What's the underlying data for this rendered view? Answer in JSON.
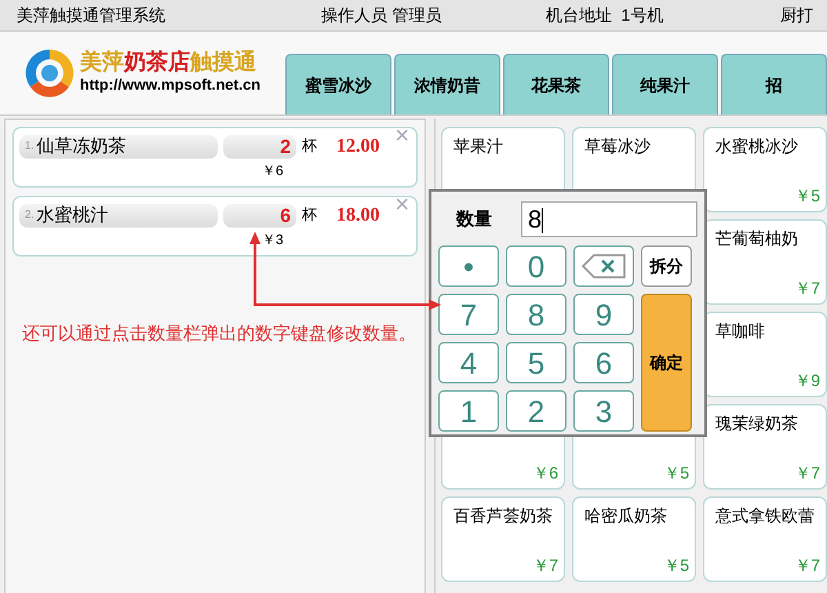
{
  "top_bar": {
    "app_name": "美萍触摸通管理系统",
    "operator": "操作人员 管理员",
    "terminal": "机台地址  1号机",
    "cut_text": "厨打"
  },
  "logo": {
    "parts": [
      {
        "text": "美萍",
        "color": "#d9a520"
      },
      {
        "text": "奶茶店",
        "color": "#d42020"
      },
      {
        "text": "触摸通",
        "color": "#d9a520"
      }
    ],
    "url": "http://www.mpsoft.net.cn"
  },
  "tabs": [
    {
      "label": "蜜雪冰沙"
    },
    {
      "label": "浓情奶昔"
    },
    {
      "label": "花果茶"
    },
    {
      "label": "纯果汁"
    },
    {
      "label": "招"
    }
  ],
  "order_items": [
    {
      "index": "1.",
      "name": "仙草冻奶茶",
      "qty": "2",
      "unit": "杯",
      "amount": "12.00",
      "unit_price": "￥6",
      "close": "×"
    },
    {
      "index": "2.",
      "name": "水蜜桃汁",
      "qty": "6",
      "unit": "杯",
      "amount": "18.00",
      "unit_price": "￥3",
      "close": "×"
    }
  ],
  "annotation": "还可以通过点击数量栏弹出的数字键盘修改数量。",
  "product_rows": [
    [
      {
        "name": "苹果汁"
      },
      {
        "name": "草莓冰沙"
      },
      {
        "name": "水蜜桃冰沙",
        "price": "￥5"
      }
    ],
    [
      null,
      null,
      {
        "name": "芒葡萄柚奶",
        "price": "￥7"
      }
    ],
    [
      null,
      null,
      {
        "name": "草咖啡",
        "price": "￥9"
      }
    ],
    [
      {
        "price": "￥6"
      },
      {
        "price": "￥5"
      },
      {
        "name": "瑰茉绿奶茶",
        "price": "￥7"
      }
    ],
    [
      {
        "name": "百香芦荟奶茶",
        "price": "￥7"
      },
      {
        "name": "哈密瓜奶茶",
        "price": "￥5"
      },
      {
        "name": "意式拿铁欧蕾",
        "price": "￥7"
      }
    ]
  ],
  "keypad": {
    "label": "数量",
    "value": "8",
    "keys": [
      {
        "kind": "key",
        "text": "•"
      },
      {
        "kind": "key",
        "text": "0"
      },
      {
        "kind": "backspace"
      },
      {
        "kind": "key",
        "text": "7"
      },
      {
        "kind": "key",
        "text": "8"
      },
      {
        "kind": "key",
        "text": "9"
      },
      {
        "kind": "key",
        "text": "4"
      },
      {
        "kind": "key",
        "text": "5"
      },
      {
        "kind": "key",
        "text": "6"
      },
      {
        "kind": "key",
        "text": "1"
      },
      {
        "kind": "key",
        "text": "2"
      },
      {
        "kind": "key",
        "text": "3"
      }
    ],
    "side_keys": [
      {
        "kind": "side",
        "text": "拆分"
      },
      {
        "kind": "confirm",
        "text": "确定"
      }
    ]
  }
}
